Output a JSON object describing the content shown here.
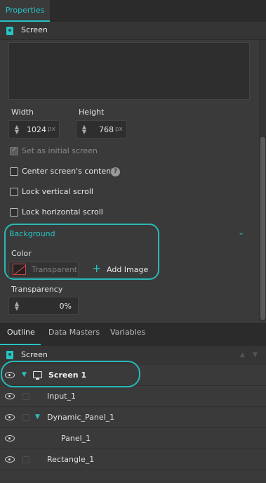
{
  "tabs": {
    "properties": "Properties"
  },
  "screen_header": {
    "title": "Screen"
  },
  "size": {
    "width_label": "Width",
    "width_value": "1024",
    "width_unit": "px",
    "height_label": "Height",
    "height_value": "768",
    "height_unit": "px"
  },
  "options": {
    "initial_screen": "Set as initial screen",
    "center_content": "Center screen's content",
    "lock_vertical": "Lock vertical scroll",
    "lock_horizontal": "Lock horizontal scroll"
  },
  "background": {
    "header": "Background",
    "color_label": "Color",
    "color_value": "Transparent",
    "add_image": "Add Image"
  },
  "transparency": {
    "label": "Transparency",
    "value": "0%"
  },
  "outline_tabs": [
    "Outline",
    "Data Masters",
    "Variables"
  ],
  "outline_header": "Screen",
  "outline_items": [
    "Screen 1",
    "Input_1",
    "Dynamic_Panel_1",
    "Panel_1",
    "Rectangle_1"
  ],
  "colors": {
    "accent": "#29c2c2",
    "panel_bg": "#3a3a3a",
    "header_bg": "#2b2b2b"
  },
  "icons": [
    "document-icon",
    "help-icon",
    "plus-icon",
    "eye-icon",
    "chevron-down-icon",
    "monitor-icon"
  ]
}
